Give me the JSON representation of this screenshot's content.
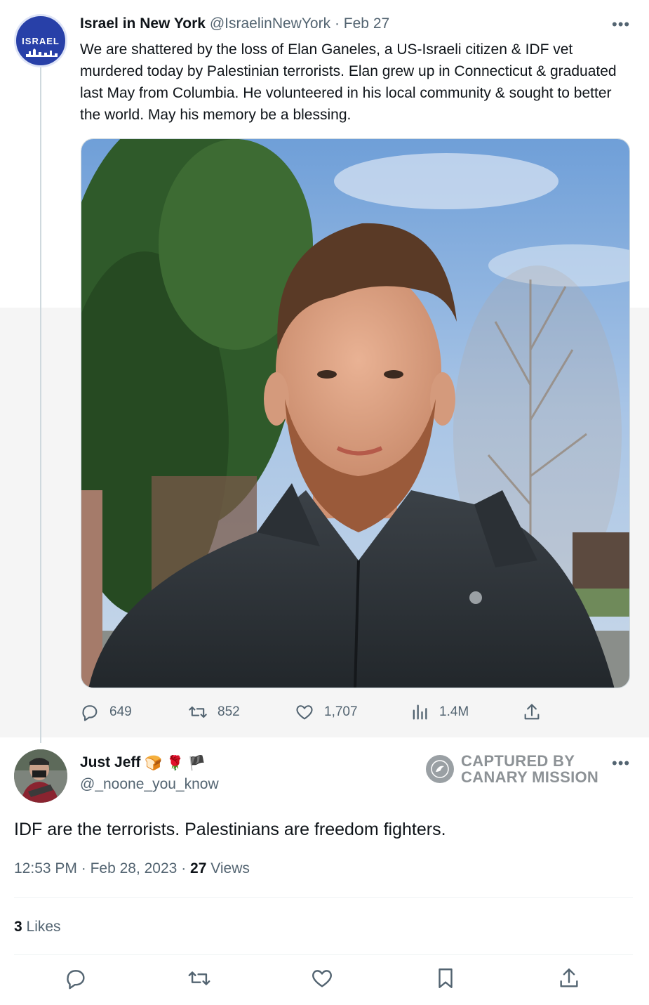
{
  "parent_tweet": {
    "author_name": "Israel in New York",
    "handle": "@IsraelinNewYork",
    "separator": "·",
    "date": "Feb 27",
    "avatar_text": "ISRAEL",
    "text": "We are shattered by the loss of Elan Ganeles, a US-Israeli citizen & IDF vet murdered today by Palestinian terrorists. Elan grew up in Connecticut & graduated last May from Columbia. He volunteered in his local community & sought to better the world. May his memory be a blessing.",
    "stats": {
      "replies": "649",
      "retweets": "852",
      "likes": "1,707",
      "views": "1.4M"
    }
  },
  "reply_tweet": {
    "author_name": "Just Jeff",
    "name_emojis": [
      "🍞",
      "🌹",
      "🏴"
    ],
    "handle": "@_noone_you_know",
    "text": "IDF are the terrorists. Palestinians are freedom fighters.",
    "time": "12:53 PM",
    "sep1": "·",
    "date": "Feb 28, 2023",
    "sep2": "·",
    "views_count": "27",
    "views_label": "Views",
    "likes_count": "3",
    "likes_label": "Likes"
  },
  "watermark": {
    "line1": "CAPTURED BY",
    "line2": "CANARY MISSION"
  },
  "more_icon": "•••",
  "colors": {
    "muted": "#536471",
    "text": "#0f1419",
    "avatar_blue": "#2840a8",
    "watermark_gray": "#8d9296"
  },
  "icons": [
    "reply-icon",
    "retweet-icon",
    "like-icon",
    "views-icon",
    "share-icon",
    "bookmark-icon",
    "more-icon",
    "canary-badge-icon"
  ]
}
